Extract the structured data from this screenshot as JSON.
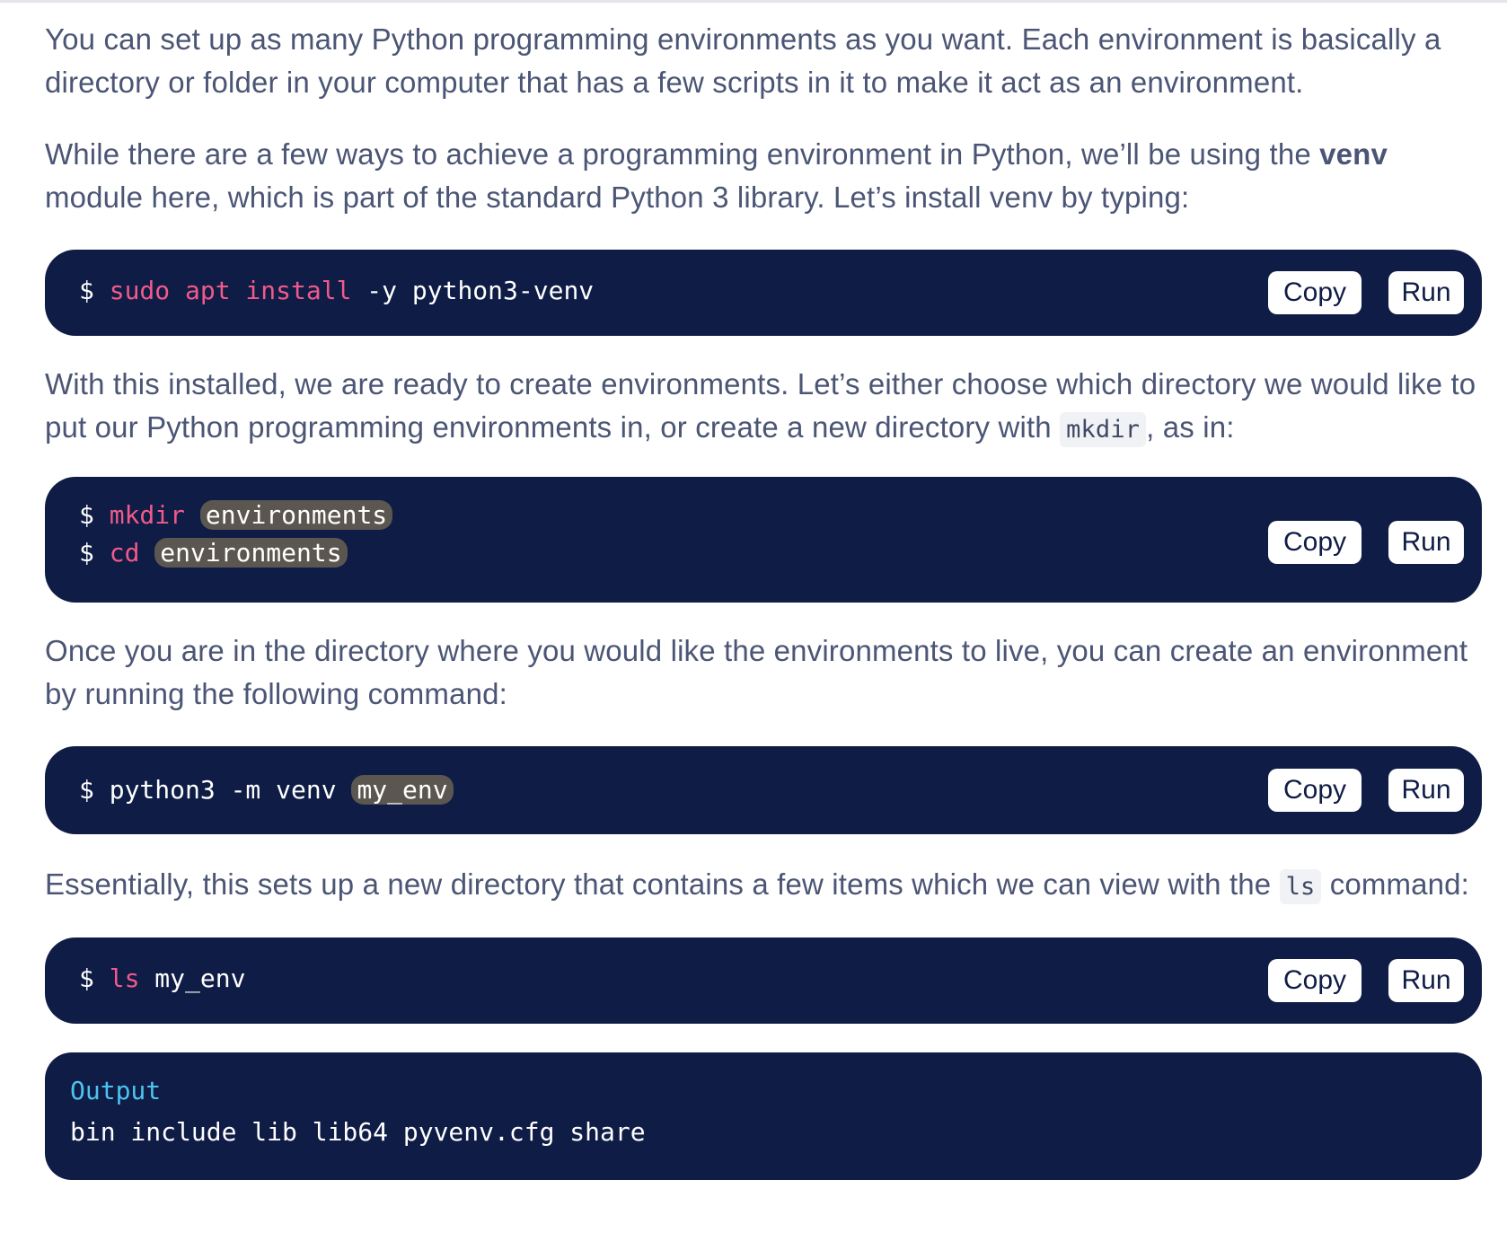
{
  "paragraphs": {
    "p1": "You can set up as many Python programming environments as you want. Each environment is basically a directory or folder in your computer that has a few scripts in it to make it act as an environment.",
    "p2_before": "While there are a few ways to achieve a programming environment in Python, we’ll be using the ",
    "p2_bold": "venv",
    "p2_after": " module here, which is part of the standard Python 3 library. Let’s install venv by typing:",
    "p3_before": "With this installed, we are ready to create environments. Let’s either choose which directory we would like to put our Python programming environments in, or create a new directory with ",
    "p3_code": "mkdir",
    "p3_after": ", as in:",
    "p4": "Once you are in the directory where you would like the environments to live, you can create an environment by running the following command:",
    "p5_before": "Essentially, this sets up a new directory that contains a few items which we can view with the ",
    "p5_code": "ls",
    "p5_after": " command:"
  },
  "code_blocks": {
    "b1": {
      "prompt": "$",
      "cmd1": "sudo apt install",
      "rest": "-y python3-venv"
    },
    "b2": {
      "line1": {
        "prompt": "$",
        "cmd": "mkdir",
        "arg": "environments"
      },
      "line2": {
        "prompt": "$",
        "cmd": "cd",
        "arg": "environments"
      }
    },
    "b3": {
      "prompt": "$",
      "text": "python3 -m venv",
      "arg": "my_env"
    },
    "b4": {
      "prompt": "$",
      "cmd": "ls",
      "rest": "my_env"
    }
  },
  "output": {
    "label": "Output",
    "text": "bin include lib lib64 pyvenv.cfg share"
  },
  "buttons": {
    "copy": "Copy",
    "run": "Run"
  },
  "colors": {
    "code_bg": "#0f1c45",
    "keyword": "#f05a8a",
    "output_label": "#4cc3f0",
    "highlight": "#5b5750",
    "body_text": "#4b5575"
  }
}
